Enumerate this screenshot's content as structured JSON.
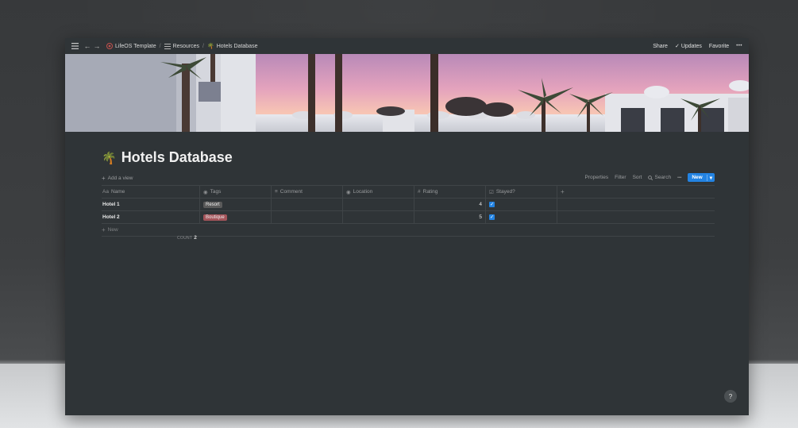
{
  "topbar": {
    "breadcrumbs": [
      {
        "label": "LifeOS Template",
        "icon": "lifeos-logo-icon"
      },
      {
        "label": "Resources",
        "icon": "list-icon"
      },
      {
        "label": "Hotels Database",
        "icon": "palm-tree-icon"
      }
    ],
    "share_label": "Share",
    "updates_label": "Updates",
    "favorite_label": "Favorite",
    "more_label": "•••"
  },
  "page": {
    "icon": "palm-tree-icon",
    "title": "Hotels Database"
  },
  "viewbar": {
    "add_view_label": "Add a view",
    "properties_label": "Properties",
    "filter_label": "Filter",
    "sort_label": "Sort",
    "search_label": "Search",
    "more_label": "•••",
    "new_label": "New"
  },
  "table": {
    "columns": [
      {
        "label": "Name",
        "icon": "text-icon"
      },
      {
        "label": "Tags",
        "icon": "select-icon"
      },
      {
        "label": "Comment",
        "icon": "lines-icon"
      },
      {
        "label": "Location",
        "icon": "select-icon"
      },
      {
        "label": "Rating",
        "icon": "hash-icon"
      },
      {
        "label": "Stayed?",
        "icon": "checkbox-icon"
      }
    ],
    "rows": [
      {
        "name": "Hotel 1",
        "tag": "Resort",
        "tag_color": "#5a5a5a",
        "comment": "",
        "location": "",
        "rating": "4",
        "stayed": true
      },
      {
        "name": "Hotel 2",
        "tag": "Boutique",
        "tag_color": "#a3545a",
        "comment": "",
        "location": "",
        "rating": "5",
        "stayed": true
      }
    ],
    "new_row_label": "New",
    "count_label": "COUNT",
    "count_value": "2"
  },
  "help_label": "?",
  "colors": {
    "accent": "#2383e2",
    "background": "#2f3437"
  }
}
